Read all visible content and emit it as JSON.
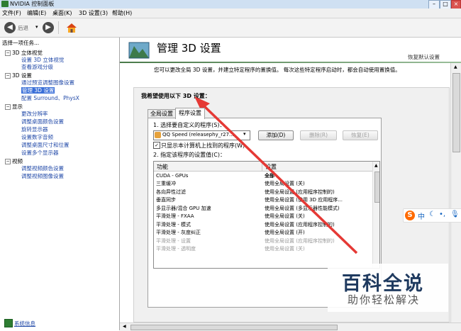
{
  "window": {
    "title": "NVIDIA 控制面板"
  },
  "menu": {
    "items": [
      "文件(F)",
      "编辑(E)",
      "桌面(K)",
      "3D 设置(3)",
      "帮助(H)"
    ]
  },
  "toolbar": {
    "back_label": "后退"
  },
  "sidebar": {
    "task_label": "选择一项任务...",
    "groups": [
      {
        "label": "3D 立体视觉",
        "items": [
          "设置 3D 立体视觉",
          "查看游戏分级"
        ]
      },
      {
        "label": "3D 设置",
        "items": [
          "通过预览调整图像设置",
          "管理 3D 设置",
          "配置 Surround、PhysX"
        ]
      },
      {
        "label": "显示",
        "items": [
          "更改分辨率",
          "调整桌面颜色设置",
          "旋转显示器",
          "设置数字音频",
          "调整桌面尺寸和位置",
          "设置多个显示器"
        ]
      },
      {
        "label": "视频",
        "items": [
          "调整视频颜色设置",
          "调整视频图像设置"
        ]
      }
    ],
    "system_info": "系统信息"
  },
  "header": {
    "title": "管理 3D 设置",
    "restore": "恢复默认设置",
    "description": "您可以更改全局 3D 设置，并建立特定程序的置换值。 每次这些特定程序启动时，都会自动使用置换值。"
  },
  "main": {
    "prompt": "我希望使用以下 3D 设置：",
    "tabs": [
      "全局设置",
      "程序设置"
    ],
    "active_tab": 1,
    "step1": "1. 选择要自定义的程序(S)：",
    "program_value": "QQ Speed (releasephy_r27...",
    "add_btn": "添加(D)",
    "remove_btn": "删除(R)",
    "restore_btn": "恢复(E)",
    "checkbox_label": "只显示本计算机上找到的程序(W)",
    "checkbox_checked": true,
    "step2": "2. 指定该程序的设置值(C)：",
    "col_feature": "功能",
    "col_setting": "设置",
    "rows": [
      {
        "f": "CUDA - GPUs",
        "s": "全部"
      },
      {
        "f": "三重缓冲",
        "s": "使用全局设置 (关)"
      },
      {
        "f": "各向异性过滤",
        "s": "使用全局设置 (应用程序控制的)"
      },
      {
        "f": "垂直同步",
        "s": "使用全局设置 (使用 3D 应用程序..."
      },
      {
        "f": "多显示器/混合 GPU 加速",
        "s": "使用全局设置 (多显示器性能模式)"
      },
      {
        "f": "平滑处理 - FXAA",
        "s": "使用全局设置 (关)"
      },
      {
        "f": "平滑处理 - 模式",
        "s": "使用全局设置 (应用程序控制的)"
      },
      {
        "f": "平滑处理 - 灰度纠正",
        "s": "使用全局设置 (开)"
      },
      {
        "f": "平滑处理 - 设置",
        "s": "使用全局设置 (应用程序控制的)"
      },
      {
        "f": "平滑处理 - 透明度",
        "s": "使用全局设置 (关)"
      }
    ]
  },
  "ime": {
    "logo": "S",
    "label": "中"
  },
  "watermark": {
    "title": "百科全说",
    "subtitle": "助你轻松解决"
  },
  "colors": {
    "accent": "#3a6fd8",
    "arrow": "#e53935",
    "link": "#2149a8"
  }
}
